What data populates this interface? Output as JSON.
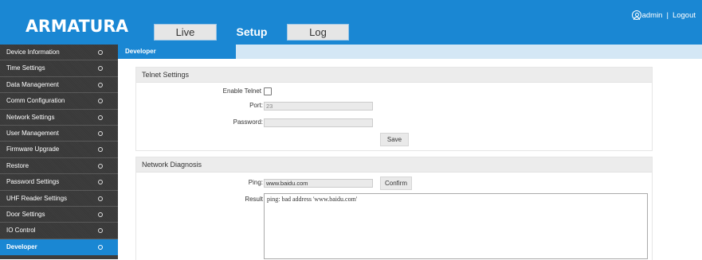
{
  "header": {
    "logo": "ARMATURA",
    "tabs": {
      "live": "Live",
      "setup": "Setup",
      "log": "Log"
    },
    "user": "admin",
    "separator": "|",
    "logout": "Logout"
  },
  "sidebar": {
    "items": [
      {
        "label": "Device Information"
      },
      {
        "label": "Time Settings"
      },
      {
        "label": "Data Management"
      },
      {
        "label": "Comm Configuration"
      },
      {
        "label": "Network Settings"
      },
      {
        "label": "User Management"
      },
      {
        "label": "Firmware Upgrade"
      },
      {
        "label": "Restore"
      },
      {
        "label": "Password Settings"
      },
      {
        "label": "UHF Reader Settings"
      },
      {
        "label": "Door Settings"
      },
      {
        "label": "IO Control"
      },
      {
        "label": "Developer",
        "active": true
      }
    ]
  },
  "page_tab": "Developer",
  "telnet": {
    "title": "Telnet Settings",
    "enable_label": "Enable Telnet",
    "port_label": "Port",
    "port_value": "23",
    "password_label": "Password",
    "password_value": "",
    "save_label": "Save"
  },
  "diagnosis": {
    "title": "Network Diagnosis",
    "ping_label": "Ping",
    "ping_value": "www.baidu.com",
    "confirm_label": "Confirm",
    "result_label": "Result",
    "result_value": "ping: bad address 'www.baidu.com'"
  },
  "colors": {
    "accent": "#1a87d3",
    "sidebar_bg": "#3d3d3d"
  }
}
